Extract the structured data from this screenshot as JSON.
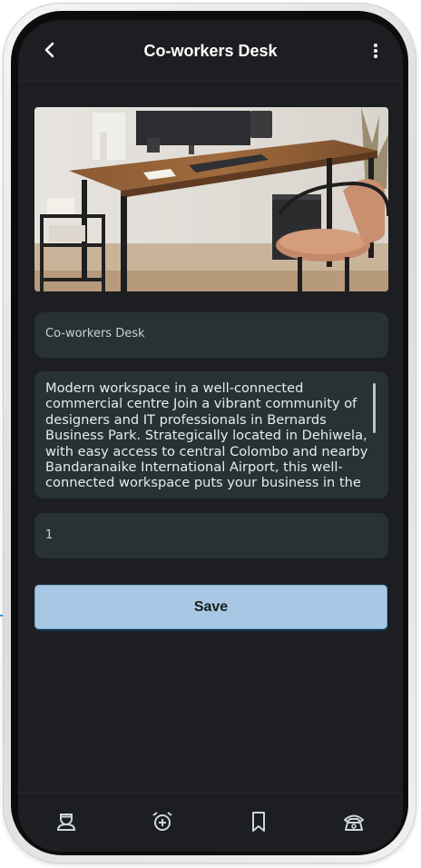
{
  "appbar": {
    "title": "Co-workers Desk",
    "back_icon": "back-arrow-icon",
    "menu_icon": "more-vertical-icon"
  },
  "listing": {
    "image": "office-desk-photo",
    "name_value": "Co-workers Desk",
    "description_value": "Modern workspace in a well-connected commercial centre Join a vibrant community of designers and IT professionals in Bernards Business Park. Strategically located in Dehiwela, with easy access to central Colombo and nearby Bandaranaike International Airport, this well-connected workspace puts your business in the",
    "quantity_value": "1"
  },
  "actions": {
    "save_label": "Save"
  },
  "bottom_nav": {
    "items": [
      {
        "icon": "user-icon"
      },
      {
        "icon": "alarm-add-icon"
      },
      {
        "icon": "bookmark-icon"
      },
      {
        "icon": "phone-icon"
      }
    ]
  },
  "colors": {
    "screen_bg": "#1c1e21",
    "field_bg": "#283235",
    "save_button": "#a7c7e4"
  }
}
